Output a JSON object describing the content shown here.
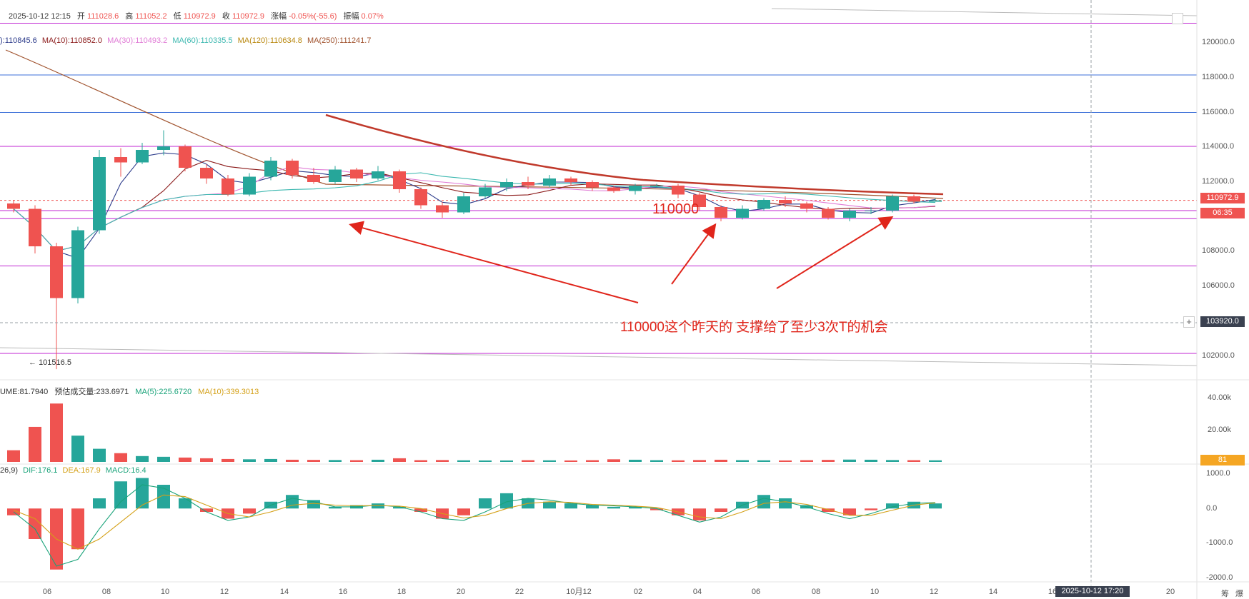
{
  "header": {
    "date_label": "2025-10-12 12:15",
    "open_label": "开",
    "open": "111028.6",
    "high_label": "高",
    "high": "111052.2",
    "low_label": "低",
    "low": "110972.9",
    "close_label": "收",
    "close": "110972.9",
    "change_label": "涨幅",
    "change": "-0.05%(-55.6)",
    "amplitude_label": "振幅",
    "amplitude": "0.07%"
  },
  "ma_legend": [
    {
      "text": "):110845.6",
      "color": "#2b3a8a"
    },
    {
      "text": "MA(10):110852.0",
      "color": "#8b1a1a"
    },
    {
      "text": "MA(30):110493.2",
      "color": "#e07bd6"
    },
    {
      "text": "MA(60):110335.5",
      "color": "#3cb8b0"
    },
    {
      "text": "MA(120):110634.8",
      "color": "#b8860b"
    },
    {
      "text": "MA(250):111241.7",
      "color": "#a0522d"
    }
  ],
  "volume_legend": [
    {
      "text": "UME:81.7940",
      "color": "#333333"
    },
    {
      "text": "预估成交量:233.6971",
      "color": "#333333"
    },
    {
      "text": "MA(5):225.6720",
      "color": "#1aa37a"
    },
    {
      "text": "MA(10):339.3013",
      "color": "#d4a017"
    }
  ],
  "macd_legend": [
    {
      "text": "26,9)",
      "color": "#333333"
    },
    {
      "text": "DIF:176.1",
      "color": "#1aa37a"
    },
    {
      "text": "DEA:167.9",
      "color": "#d4a017"
    },
    {
      "text": "MACD:16.4",
      "color": "#1aa37a"
    }
  ],
  "price_axis": [
    "120000.0",
    "118000.0",
    "116000.0",
    "114000.0",
    "112000.0",
    "108000.0",
    "106000.0",
    "102000.0"
  ],
  "price_tags": {
    "current": "110972.9",
    "countdown": "06:35",
    "crosshair": "103920.0"
  },
  "volume_axis": [
    "40.00k",
    "20.00k"
  ],
  "volume_tag": "81",
  "macd_axis": [
    "1000.0",
    "0.0",
    "-1000.0",
    "-2000.0"
  ],
  "time_axis": [
    "06",
    "08",
    "10",
    "12",
    "14",
    "16",
    "18",
    "20",
    "22",
    "10月12",
    "02",
    "04",
    "06",
    "08",
    "10",
    "12",
    "14",
    "16",
    "20"
  ],
  "crosshair_time": "2025-10-12 17:20",
  "low_marker": "101516.5",
  "annotations": {
    "level_label": "110000",
    "note": "110000这个昨天的 支撑给了至少3次T的机会"
  },
  "corner_labels": [
    "筹",
    "爆"
  ],
  "colors": {
    "up": "#26a69a",
    "down": "#ef5350",
    "annotation": "#e0251b",
    "hline_purple": "#c026d3",
    "hline_blue": "#3b6fd8",
    "ma250": "#c0392b"
  },
  "chart_data": {
    "type": "candlestick",
    "ylim": [
      101000,
      121000
    ],
    "horizontal_levels": [
      120900,
      114000,
      110400,
      109950,
      107300,
      102400,
      118000,
      115900
    ],
    "support_level": 110000,
    "candles": [
      {
        "o": 110800,
        "h": 111000,
        "l": 110300,
        "c": 110500
      },
      {
        "o": 110500,
        "h": 110700,
        "l": 108000,
        "c": 108400
      },
      {
        "o": 108400,
        "h": 108600,
        "l": 101516.5,
        "c": 105500
      },
      {
        "o": 105500,
        "h": 109500,
        "l": 105200,
        "c": 109300
      },
      {
        "o": 109300,
        "h": 113800,
        "l": 109100,
        "c": 113400
      },
      {
        "o": 113400,
        "h": 113900,
        "l": 112300,
        "c": 113100
      },
      {
        "o": 113100,
        "h": 114200,
        "l": 113000,
        "c": 113800
      },
      {
        "o": 113800,
        "h": 114900,
        "l": 113500,
        "c": 114000
      },
      {
        "o": 114000,
        "h": 114100,
        "l": 112600,
        "c": 112800
      },
      {
        "o": 112800,
        "h": 113000,
        "l": 111900,
        "c": 112200
      },
      {
        "o": 112200,
        "h": 112400,
        "l": 111200,
        "c": 111300
      },
      {
        "o": 111300,
        "h": 112500,
        "l": 111200,
        "c": 112300
      },
      {
        "o": 112300,
        "h": 113400,
        "l": 112100,
        "c": 113200
      },
      {
        "o": 113200,
        "h": 113300,
        "l": 112200,
        "c": 112400
      },
      {
        "o": 112400,
        "h": 112800,
        "l": 111900,
        "c": 112000
      },
      {
        "o": 112000,
        "h": 112900,
        "l": 111900,
        "c": 112700
      },
      {
        "o": 112700,
        "h": 112800,
        "l": 112000,
        "c": 112200
      },
      {
        "o": 112200,
        "h": 112900,
        "l": 112100,
        "c": 112600
      },
      {
        "o": 112600,
        "h": 112700,
        "l": 111400,
        "c": 111600
      },
      {
        "o": 111600,
        "h": 111700,
        "l": 110500,
        "c": 110700
      },
      {
        "o": 110700,
        "h": 110900,
        "l": 110000,
        "c": 110300
      },
      {
        "o": 110300,
        "h": 111400,
        "l": 110200,
        "c": 111200
      },
      {
        "o": 111200,
        "h": 111900,
        "l": 111100,
        "c": 111700
      },
      {
        "o": 111700,
        "h": 112200,
        "l": 111500,
        "c": 112000
      },
      {
        "o": 112000,
        "h": 112300,
        "l": 111600,
        "c": 111800
      },
      {
        "o": 111800,
        "h": 112400,
        "l": 111700,
        "c": 112200
      },
      {
        "o": 112200,
        "h": 112300,
        "l": 111800,
        "c": 112000
      },
      {
        "o": 112000,
        "h": 112100,
        "l": 111500,
        "c": 111700
      },
      {
        "o": 111700,
        "h": 111800,
        "l": 111400,
        "c": 111500
      },
      {
        "o": 111500,
        "h": 111900,
        "l": 111300,
        "c": 111800
      },
      {
        "o": 111800,
        "h": 111900,
        "l": 111700,
        "c": 111800
      },
      {
        "o": 111800,
        "h": 111900,
        "l": 111100,
        "c": 111300
      },
      {
        "o": 111300,
        "h": 111400,
        "l": 110400,
        "c": 110600
      },
      {
        "o": 110600,
        "h": 110700,
        "l": 109800,
        "c": 110000
      },
      {
        "o": 110000,
        "h": 110700,
        "l": 109900,
        "c": 110500
      },
      {
        "o": 110500,
        "h": 111100,
        "l": 110400,
        "c": 111000
      },
      {
        "o": 111000,
        "h": 111200,
        "l": 110600,
        "c": 110800
      },
      {
        "o": 110800,
        "h": 110900,
        "l": 110300,
        "c": 110500
      },
      {
        "o": 110500,
        "h": 110600,
        "l": 109900,
        "c": 110000
      },
      {
        "o": 110000,
        "h": 110500,
        "l": 109800,
        "c": 110400
      },
      {
        "o": 110400,
        "h": 110600,
        "l": 110200,
        "c": 110400
      },
      {
        "o": 110400,
        "h": 111300,
        "l": 110300,
        "c": 111200
      },
      {
        "o": 111200,
        "h": 111300,
        "l": 110800,
        "c": 110900
      },
      {
        "o": 110900,
        "h": 111100,
        "l": 110900,
        "c": 110973
      }
    ],
    "volume_ylim": [
      0,
      45000
    ],
    "volume": [
      8000,
      24000,
      40000,
      18000,
      9000,
      6000,
      4000,
      3500,
      3000,
      2500,
      2000,
      1800,
      2000,
      1500,
      1400,
      1300,
      1200,
      1500,
      2500,
      1200,
      1300,
      1100,
      1000,
      1000,
      1200,
      1100,
      1000,
      1200,
      1800,
      1500,
      1200,
      1100,
      1300,
      1500,
      1200,
      1100,
      1000,
      1200,
      1400,
      1600,
      1500,
      1300,
      1200,
      1100
    ],
    "macd_ylim": [
      -2100,
      1100
    ],
    "macd_hist": [
      -200,
      -900,
      -1800,
      -1200,
      300,
      800,
      900,
      700,
      300,
      -100,
      -300,
      -150,
      200,
      400,
      250,
      50,
      100,
      150,
      50,
      -100,
      -300,
      -200,
      300,
      450,
      300,
      200,
      150,
      100,
      50,
      50,
      -50,
      -200,
      -350,
      -100,
      200,
      400,
      300,
      100,
      -100,
      -200,
      -50,
      150,
      200,
      150
    ],
    "dif": [
      -100,
      -600,
      -1700,
      -1500,
      -600,
      200,
      700,
      600,
      300,
      -100,
      -350,
      -250,
      100,
      300,
      200,
      50,
      50,
      100,
      50,
      -100,
      -300,
      -350,
      -100,
      200,
      300,
      250,
      150,
      100,
      80,
      50,
      0,
      -200,
      -400,
      -250,
      100,
      300,
      200,
      50,
      -150,
      -300,
      -150,
      50,
      150,
      176
    ],
    "dea": [
      -50,
      -300,
      -900,
      -1200,
      -900,
      -400,
      100,
      400,
      350,
      100,
      -150,
      -250,
      -100,
      100,
      150,
      100,
      80,
      90,
      70,
      0,
      -150,
      -280,
      -200,
      0,
      150,
      200,
      180,
      120,
      100,
      70,
      30,
      -100,
      -250,
      -300,
      -100,
      150,
      200,
      120,
      -30,
      -200,
      -200,
      -50,
      100,
      168
    ]
  }
}
